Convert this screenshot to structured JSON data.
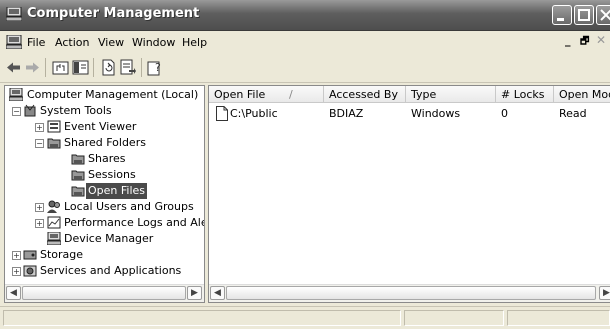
{
  "window": {
    "title": "Computer Management"
  },
  "menu": {
    "items": [
      "File",
      "Action",
      "View",
      "Window",
      "Help"
    ]
  },
  "tree": {
    "items": [
      {
        "label": "Computer Management (Local)"
      },
      {
        "label": "System Tools"
      },
      {
        "label": "Event Viewer"
      },
      {
        "label": "Shared Folders"
      },
      {
        "label": "Shares"
      },
      {
        "label": "Sessions"
      },
      {
        "label": "Open Files",
        "selected": true
      },
      {
        "label": "Local Users and Groups"
      },
      {
        "label": "Performance Logs and Alerts"
      },
      {
        "label": "Device Manager"
      },
      {
        "label": "Storage"
      },
      {
        "label": "Services and Applications"
      }
    ]
  },
  "list": {
    "columns": [
      "Open File",
      "Accessed By",
      "Type",
      "# Locks",
      "Open Mode"
    ],
    "sort_indicator": "/",
    "rows": [
      {
        "open_file": "C:\\Public",
        "accessed_by": "BDIAZ",
        "type": "Windows",
        "locks": "0",
        "open_mode": "Read"
      }
    ]
  }
}
